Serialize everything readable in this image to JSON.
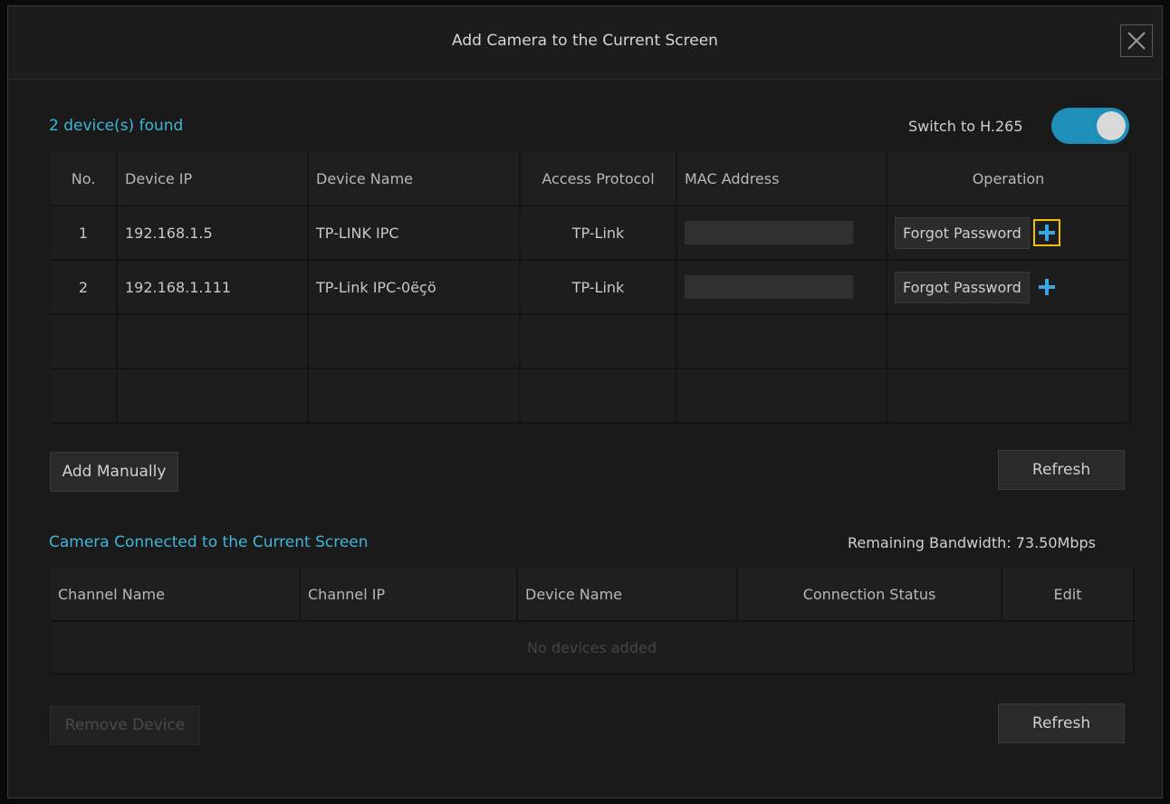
{
  "dialog": {
    "title": "Add Camera to the Current Screen",
    "close_icon": "close-icon"
  },
  "discovery": {
    "found_label": "2 device(s) found",
    "h265_label": "Switch to H.265",
    "h265_enabled": true,
    "columns": [
      "No.",
      "Device IP",
      "Device Name",
      "Access Protocol",
      "MAC Address",
      "Operation"
    ],
    "rows": [
      {
        "no": "1",
        "ip": "192.168.1.5",
        "name": "TP-LINK IPC",
        "protocol": "TP-Link",
        "operation": "Forgot Password"
      },
      {
        "no": "2",
        "ip": "192.168.1.111",
        "name": "TP-Link IPC-0ëçö",
        "protocol": "TP-Link",
        "operation": "Forgot Password"
      }
    ],
    "add_manually_label": "Add Manually",
    "refresh_label": "Refresh"
  },
  "connected": {
    "section_label": "Camera Connected to the Current Screen",
    "bandwidth_label": "Remaining Bandwidth: 73.50Mbps",
    "columns": [
      "Channel Name",
      "Channel IP",
      "Device Name",
      "Connection Status",
      "Edit"
    ],
    "empty_message": "No devices added",
    "remove_label": "Remove Device",
    "refresh_label": "Refresh"
  },
  "colors": {
    "accent": "#3fb6d9",
    "toggle_on": "#1e8fb8",
    "highlight": "#f0c000",
    "plus": "#3aa8e0"
  }
}
